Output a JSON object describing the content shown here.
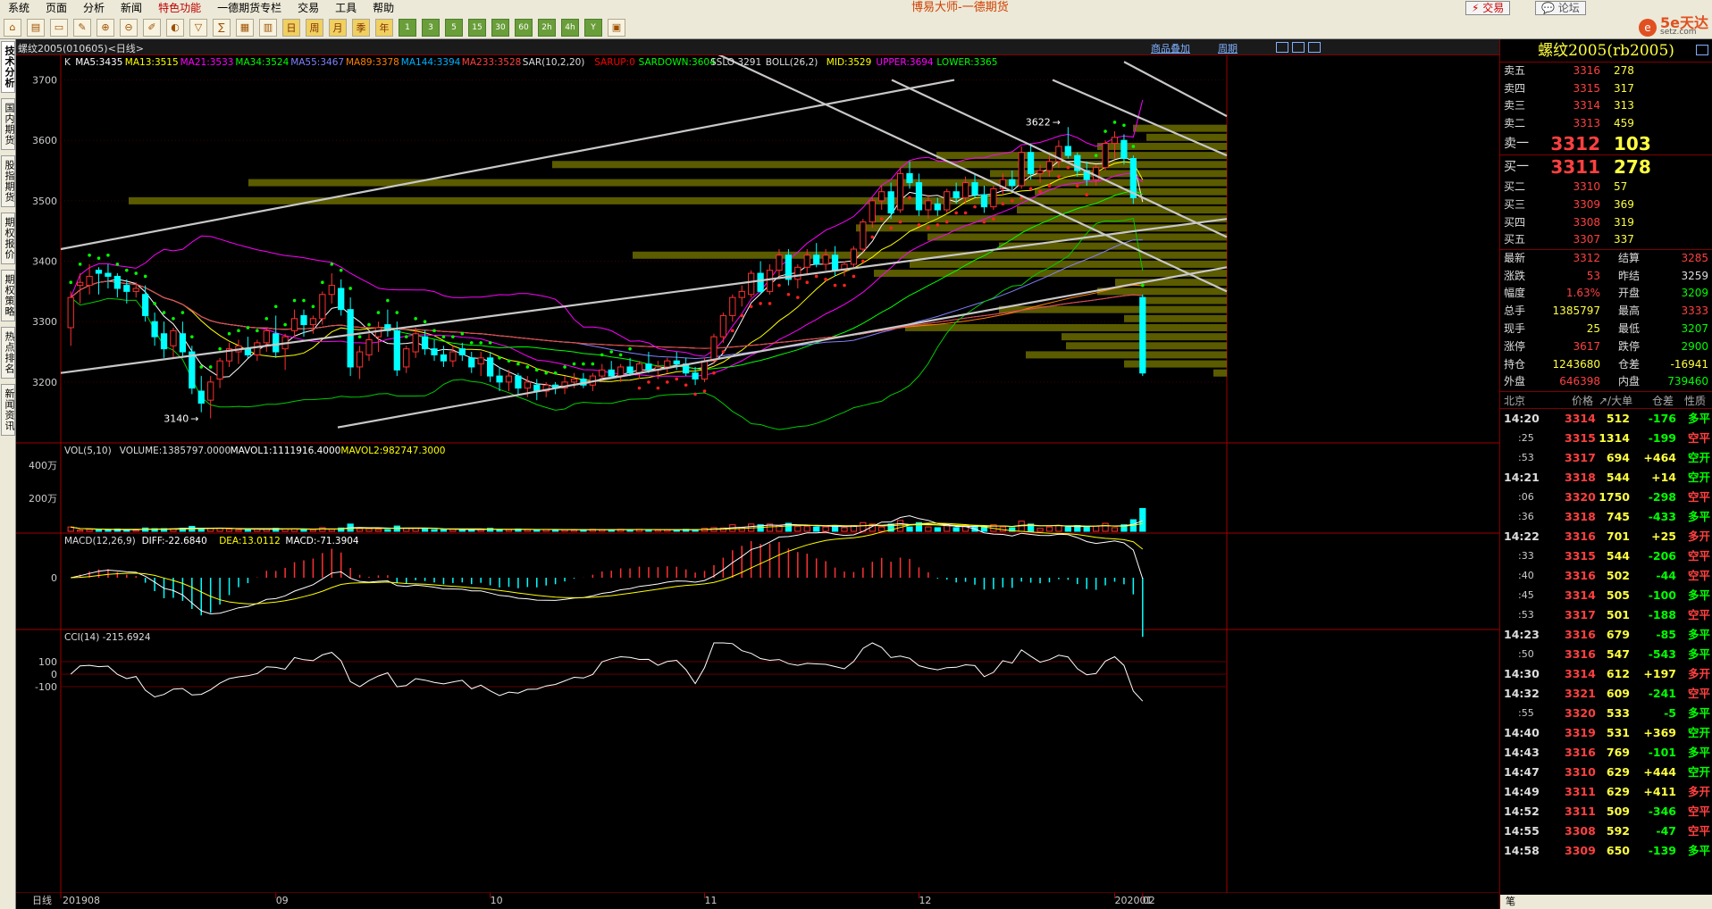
{
  "menubar": {
    "items": [
      "系统",
      "页面",
      "分析",
      "新闻",
      "特色功能",
      "一德期货专栏",
      "交易",
      "工具",
      "帮助"
    ],
    "highlight_index": 4,
    "app_title": "博易大师-一德期货",
    "trade_button": "交易",
    "forum_button": "论坛"
  },
  "toolbar": {
    "buttons": [
      "home-icon",
      "file-icon",
      "monitor-icon",
      "note-icon",
      "zoom-in-icon",
      "zoom-out-icon",
      "draw-icon",
      "paint-icon",
      "filter-icon",
      "calc-icon",
      "grid-icon",
      "bars-icon",
      "day",
      "week",
      "month",
      "quarter",
      "year",
      "1",
      "3",
      "5",
      "15",
      "30",
      "60",
      "2h",
      "4h",
      "Y",
      "calendar-icon"
    ],
    "labels": {
      "day": "日",
      "week": "周",
      "month": "月",
      "quarter": "季",
      "year": "年",
      "1": "1",
      "3": "3",
      "5": "5",
      "15": "15",
      "30": "30",
      "60": "60",
      "2h": "2h",
      "4h": "4h",
      "Y": "Y"
    }
  },
  "logo": {
    "circle": "e",
    "text": "5e天达",
    "sub": "setz.com"
  },
  "side_tabs": [
    "技术分析",
    "国内期货",
    "股指期货",
    "期权报价",
    "期权策略",
    "热点排名",
    "新闻资讯"
  ],
  "chart_header": {
    "symbol": "螺纹2005(010605)<日线>",
    "link1": "商品叠加",
    "link2": "周期"
  },
  "indicators": {
    "main": [
      {
        "text": "K",
        "color": "#dddddd"
      },
      {
        "text": "MA5:3435",
        "color": "#ffffff"
      },
      {
        "text": "MA13:3515",
        "color": "#ffff00"
      },
      {
        "text": "MA21:3533",
        "color": "#ff00ff"
      },
      {
        "text": "MA34:3524",
        "color": "#00ff00"
      },
      {
        "text": "MA55:3467",
        "color": "#8080ff"
      },
      {
        "text": "MA89:3378",
        "color": "#ff8000"
      },
      {
        "text": "MA144:3394",
        "color": "#00b0ff"
      },
      {
        "text": "MA233:3528",
        "color": "#ff4040"
      },
      {
        "text": "SAR(10,2,20)",
        "color": "#dddddd"
      },
      {
        "text": "SARUP:0",
        "color": "#ff0000"
      },
      {
        "text": "SARDOWN:3604",
        "color": "#00ff00"
      },
      {
        "text": "SSLO 3291",
        "color": "#dddddd"
      },
      {
        "text": "BOLL(26,2)",
        "color": "#dddddd"
      },
      {
        "text": "MID:3529",
        "color": "#ffff00"
      },
      {
        "text": "UPPER:3694",
        "color": "#ff00ff"
      },
      {
        "text": "LOWER:3365",
        "color": "#00ff00"
      }
    ],
    "vol": [
      {
        "text": "VOL(5,10)",
        "color": "#dddddd"
      },
      {
        "text": "VOLUME:1385797.0000",
        "color": "#dddddd"
      },
      {
        "text": "MAVOL1:1111916.4000",
        "color": "#ffffff"
      },
      {
        "text": "MAVOL2:982747.3000",
        "color": "#ffff00"
      }
    ],
    "macd": [
      {
        "text": "MACD(12,26,9)",
        "color": "#dddddd"
      },
      {
        "text": "DIFF:-22.6840",
        "color": "#ffffff"
      },
      {
        "text": "DEA:13.0112",
        "color": "#ffff00"
      },
      {
        "text": "MACD:-71.3904",
        "color": "#ffffff"
      }
    ],
    "cci": [
      {
        "text": "CCI(14) -215.6924",
        "color": "#dddddd"
      }
    ]
  },
  "y_axis": {
    "main": [
      "3700",
      "3600",
      "3500",
      "3400",
      "3300",
      "3200"
    ],
    "vol": [
      "400万",
      "200万"
    ],
    "macd": [
      "0"
    ],
    "cci": [
      "100",
      "0",
      "-100"
    ]
  },
  "x_axis": {
    "period_label": "日线",
    "dates": [
      "201908",
      "09",
      "10",
      "11",
      "12",
      "202001",
      "02"
    ]
  },
  "annotations": {
    "high": "3622",
    "low": "3140"
  },
  "chart_data": {
    "type": "candlestick",
    "ylim": [
      3120,
      3720
    ],
    "candles": [
      [
        3290,
        3350,
        3260,
        3340
      ],
      [
        3360,
        3380,
        3330,
        3365
      ],
      [
        3360,
        3395,
        3345,
        3375
      ],
      [
        3385,
        3390,
        3345,
        3380
      ],
      [
        3380,
        3395,
        3355,
        3375
      ],
      [
        3375,
        3380,
        3340,
        3355
      ],
      [
        3360,
        3370,
        3330,
        3350
      ],
      [
        3350,
        3365,
        3340,
        3355
      ],
      [
        3345,
        3360,
        3300,
        3310
      ],
      [
        3300,
        3315,
        3260,
        3275
      ],
      [
        3280,
        3300,
        3240,
        3255
      ],
      [
        3260,
        3290,
        3240,
        3285
      ],
      [
        3280,
        3300,
        3240,
        3250
      ],
      [
        3250,
        3260,
        3180,
        3190
      ],
      [
        3185,
        3210,
        3150,
        3165
      ],
      [
        3170,
        3210,
        3140,
        3200
      ],
      [
        3205,
        3240,
        3190,
        3235
      ],
      [
        3235,
        3265,
        3225,
        3255
      ],
      [
        3250,
        3270,
        3230,
        3260
      ],
      [
        3255,
        3275,
        3240,
        3245
      ],
      [
        3245,
        3270,
        3235,
        3265
      ],
      [
        3265,
        3290,
        3250,
        3285
      ],
      [
        3280,
        3310,
        3240,
        3250
      ],
      [
        3255,
        3280,
        3220,
        3275
      ],
      [
        3285,
        3320,
        3275,
        3305
      ],
      [
        3310,
        3320,
        3275,
        3295
      ],
      [
        3295,
        3310,
        3280,
        3305
      ],
      [
        3305,
        3350,
        3295,
        3345
      ],
      [
        3345,
        3380,
        3330,
        3360
      ],
      [
        3355,
        3370,
        3310,
        3320
      ],
      [
        3320,
        3340,
        3210,
        3225
      ],
      [
        3225,
        3260,
        3205,
        3250
      ],
      [
        3245,
        3280,
        3235,
        3270
      ],
      [
        3275,
        3300,
        3250,
        3290
      ],
      [
        3295,
        3320,
        3275,
        3285
      ],
      [
        3285,
        3300,
        3210,
        3220
      ],
      [
        3225,
        3260,
        3215,
        3255
      ],
      [
        3250,
        3290,
        3240,
        3280
      ],
      [
        3275,
        3285,
        3245,
        3255
      ],
      [
        3255,
        3270,
        3235,
        3245
      ],
      [
        3245,
        3260,
        3225,
        3235
      ],
      [
        3235,
        3260,
        3225,
        3250
      ],
      [
        3255,
        3265,
        3235,
        3245
      ],
      [
        3240,
        3250,
        3215,
        3225
      ],
      [
        3230,
        3250,
        3210,
        3240
      ],
      [
        3240,
        3250,
        3200,
        3210
      ],
      [
        3210,
        3225,
        3185,
        3200
      ],
      [
        3200,
        3220,
        3185,
        3210
      ],
      [
        3210,
        3215,
        3180,
        3190
      ],
      [
        3190,
        3210,
        3175,
        3200
      ],
      [
        3195,
        3205,
        3170,
        3185
      ],
      [
        3185,
        3200,
        3175,
        3195
      ],
      [
        3195,
        3200,
        3180,
        3190
      ],
      [
        3190,
        3210,
        3180,
        3200
      ],
      [
        3200,
        3215,
        3190,
        3205
      ],
      [
        3205,
        3215,
        3190,
        3195
      ],
      [
        3195,
        3215,
        3185,
        3210
      ],
      [
        3210,
        3230,
        3200,
        3220
      ],
      [
        3220,
        3235,
        3205,
        3210
      ],
      [
        3210,
        3230,
        3200,
        3225
      ],
      [
        3225,
        3240,
        3210,
        3215
      ],
      [
        3215,
        3235,
        3205,
        3230
      ],
      [
        3230,
        3250,
        3215,
        3220
      ],
      [
        3220,
        3235,
        3205,
        3225
      ],
      [
        3225,
        3240,
        3215,
        3235
      ],
      [
        3235,
        3250,
        3220,
        3230
      ],
      [
        3230,
        3240,
        3210,
        3215
      ],
      [
        3215,
        3225,
        3195,
        3205
      ],
      [
        3205,
        3240,
        3200,
        3235
      ],
      [
        3235,
        3280,
        3230,
        3275
      ],
      [
        3275,
        3315,
        3265,
        3310
      ],
      [
        3310,
        3345,
        3300,
        3340
      ],
      [
        3340,
        3360,
        3325,
        3350
      ],
      [
        3345,
        3385,
        3340,
        3380
      ],
      [
        3380,
        3400,
        3345,
        3350
      ],
      [
        3350,
        3395,
        3345,
        3385
      ],
      [
        3385,
        3420,
        3375,
        3410
      ],
      [
        3410,
        3420,
        3360,
        3370
      ],
      [
        3370,
        3395,
        3355,
        3390
      ],
      [
        3390,
        3420,
        3380,
        3410
      ],
      [
        3410,
        3430,
        3390,
        3395
      ],
      [
        3395,
        3420,
        3385,
        3410
      ],
      [
        3410,
        3425,
        3375,
        3385
      ],
      [
        3385,
        3400,
        3375,
        3395
      ],
      [
        3395,
        3425,
        3390,
        3420
      ],
      [
        3420,
        3470,
        3415,
        3465
      ],
      [
        3465,
        3505,
        3455,
        3500
      ],
      [
        3500,
        3525,
        3485,
        3515
      ],
      [
        3515,
        3530,
        3470,
        3480
      ],
      [
        3485,
        3555,
        3480,
        3545
      ],
      [
        3545,
        3565,
        3520,
        3530
      ],
      [
        3530,
        3545,
        3475,
        3485
      ],
      [
        3485,
        3510,
        3470,
        3500
      ],
      [
        3495,
        3505,
        3475,
        3485
      ],
      [
        3485,
        3520,
        3480,
        3515
      ],
      [
        3515,
        3530,
        3495,
        3505
      ],
      [
        3505,
        3540,
        3495,
        3530
      ],
      [
        3530,
        3545,
        3505,
        3510
      ],
      [
        3510,
        3525,
        3480,
        3490
      ],
      [
        3490,
        3525,
        3485,
        3520
      ],
      [
        3520,
        3545,
        3510,
        3535
      ],
      [
        3535,
        3550,
        3515,
        3525
      ],
      [
        3525,
        3590,
        3520,
        3580
      ],
      [
        3580,
        3595,
        3535,
        3545
      ],
      [
        3545,
        3560,
        3530,
        3550
      ],
      [
        3550,
        3575,
        3540,
        3565
      ],
      [
        3565,
        3600,
        3555,
        3590
      ],
      [
        3590,
        3622,
        3570,
        3575
      ],
      [
        3575,
        3580,
        3540,
        3550
      ],
      [
        3550,
        3565,
        3525,
        3535
      ],
      [
        3535,
        3560,
        3525,
        3555
      ],
      [
        3555,
        3600,
        3550,
        3595
      ],
      [
        3595,
        3615,
        3570,
        3605
      ],
      [
        3600,
        3610,
        3560,
        3570
      ],
      [
        3570,
        3575,
        3495,
        3505
      ],
      [
        3340,
        3345,
        3210,
        3215
      ]
    ],
    "last_close": 3312
  },
  "quote": {
    "title": "螺纹2005(rb2005)",
    "asks": [
      {
        "label": "卖五",
        "price": "3316",
        "vol": "278"
      },
      {
        "label": "卖四",
        "price": "3315",
        "vol": "317"
      },
      {
        "label": "卖三",
        "price": "3314",
        "vol": "313"
      },
      {
        "label": "卖二",
        "price": "3313",
        "vol": "459"
      }
    ],
    "ask1": {
      "label": "卖一",
      "price": "3312",
      "vol": "103"
    },
    "bid1": {
      "label": "买一",
      "price": "3311",
      "vol": "278"
    },
    "bids": [
      {
        "label": "买二",
        "price": "3310",
        "vol": "57"
      },
      {
        "label": "买三",
        "price": "3309",
        "vol": "369"
      },
      {
        "label": "买四",
        "price": "3308",
        "vol": "319"
      },
      {
        "label": "买五",
        "price": "3307",
        "vol": "337"
      }
    ],
    "info": [
      {
        "l1": "最新",
        "v1": "3312",
        "c1": "red",
        "l2": "结算",
        "v2": "3285",
        "c2": "red"
      },
      {
        "l1": "涨跌",
        "v1": "53",
        "c1": "red",
        "l2": "昨结",
        "v2": "3259",
        "c2": "wht"
      },
      {
        "l1": "幅度",
        "v1": "1.63%",
        "c1": "red",
        "l2": "开盘",
        "v2": "3209",
        "c2": "grn"
      },
      {
        "l1": "总手",
        "v1": "1385797",
        "c1": "yel",
        "l2": "最高",
        "v2": "3333",
        "c2": "red"
      },
      {
        "l1": "现手",
        "v1": "25",
        "c1": "yel",
        "l2": "最低",
        "v2": "3207",
        "c2": "grn"
      },
      {
        "l1": "涨停",
        "v1": "3617",
        "c1": "red",
        "l2": "跌停",
        "v2": "2900",
        "c2": "grn"
      },
      {
        "l1": "持仓",
        "v1": "1243680",
        "c1": "yel",
        "l2": "仓差",
        "v2": "-16941",
        "c2": "yel"
      },
      {
        "l1": "外盘",
        "v1": "646398",
        "c1": "red",
        "l2": "内盘",
        "v2": "739460",
        "c2": "grn"
      }
    ],
    "ticks_header": {
      "city": "北京",
      "price": "价格",
      "vol": "↗/大单",
      "oi": "仓差",
      "nature": "性质"
    },
    "ticks": [
      {
        "t": "14:20",
        "sub": false,
        "p": "3314",
        "v": "512",
        "o": "-176",
        "n": "多平",
        "pc": "red",
        "oc": "grn",
        "nc": "grn"
      },
      {
        "t": ":25",
        "sub": true,
        "p": "3315",
        "v": "1314",
        "o": "-199",
        "n": "空平",
        "pc": "red",
        "oc": "grn",
        "nc": "red"
      },
      {
        "t": ":53",
        "sub": true,
        "p": "3317",
        "v": "694",
        "o": "+464",
        "n": "空开",
        "pc": "red",
        "oc": "yel",
        "nc": "grn"
      },
      {
        "t": "14:21",
        "sub": false,
        "p": "3318",
        "v": "544",
        "o": "+14",
        "n": "空开",
        "pc": "red",
        "oc": "yel",
        "nc": "grn"
      },
      {
        "t": ":06",
        "sub": true,
        "p": "3320",
        "v": "1750",
        "o": "-298",
        "n": "空平",
        "pc": "red",
        "oc": "grn",
        "nc": "red"
      },
      {
        "t": ":36",
        "sub": true,
        "p": "3318",
        "v": "745",
        "o": "-433",
        "n": "多平",
        "pc": "red",
        "oc": "grn",
        "nc": "grn"
      },
      {
        "t": "14:22",
        "sub": false,
        "p": "3316",
        "v": "701",
        "o": "+25",
        "n": "多开",
        "pc": "red",
        "oc": "yel",
        "nc": "red"
      },
      {
        "t": ":33",
        "sub": true,
        "p": "3315",
        "v": "544",
        "o": "-206",
        "n": "空平",
        "pc": "red",
        "oc": "grn",
        "nc": "red"
      },
      {
        "t": ":40",
        "sub": true,
        "p": "3316",
        "v": "502",
        "o": "-44",
        "n": "空平",
        "pc": "red",
        "oc": "grn",
        "nc": "red"
      },
      {
        "t": ":45",
        "sub": true,
        "p": "3314",
        "v": "505",
        "o": "-100",
        "n": "多平",
        "pc": "red",
        "oc": "grn",
        "nc": "grn"
      },
      {
        "t": ":53",
        "sub": true,
        "p": "3317",
        "v": "501",
        "o": "-188",
        "n": "空平",
        "pc": "red",
        "oc": "grn",
        "nc": "red"
      },
      {
        "t": "14:23",
        "sub": false,
        "p": "3316",
        "v": "679",
        "o": "-85",
        "n": "多平",
        "pc": "red",
        "oc": "grn",
        "nc": "grn"
      },
      {
        "t": ":50",
        "sub": true,
        "p": "3316",
        "v": "547",
        "o": "-543",
        "n": "多平",
        "pc": "red",
        "oc": "grn",
        "nc": "grn"
      },
      {
        "t": "14:30",
        "sub": false,
        "p": "3314",
        "v": "612",
        "o": "+197",
        "n": "多开",
        "pc": "red",
        "oc": "yel",
        "nc": "red"
      },
      {
        "t": "14:32",
        "sub": false,
        "p": "3321",
        "v": "609",
        "o": "-241",
        "n": "空平",
        "pc": "red",
        "oc": "grn",
        "nc": "red"
      },
      {
        "t": ":55",
        "sub": true,
        "p": "3320",
        "v": "533",
        "o": "-5",
        "n": "多平",
        "pc": "red",
        "oc": "grn",
        "nc": "grn"
      },
      {
        "t": "14:40",
        "sub": false,
        "p": "3319",
        "v": "531",
        "o": "+369",
        "n": "空开",
        "pc": "red",
        "oc": "yel",
        "nc": "grn"
      },
      {
        "t": "14:43",
        "sub": false,
        "p": "3316",
        "v": "769",
        "o": "-101",
        "n": "多平",
        "pc": "red",
        "oc": "grn",
        "nc": "grn"
      },
      {
        "t": "14:47",
        "sub": false,
        "p": "3310",
        "v": "629",
        "o": "+444",
        "n": "空开",
        "pc": "red",
        "oc": "yel",
        "nc": "grn"
      },
      {
        "t": "14:49",
        "sub": false,
        "p": "3311",
        "v": "629",
        "o": "+411",
        "n": "多开",
        "pc": "red",
        "oc": "yel",
        "nc": "red"
      },
      {
        "t": "14:52",
        "sub": false,
        "p": "3311",
        "v": "509",
        "o": "-346",
        "n": "空平",
        "pc": "red",
        "oc": "grn",
        "nc": "red"
      },
      {
        "t": "14:55",
        "sub": false,
        "p": "3308",
        "v": "592",
        "o": "-47",
        "n": "空平",
        "pc": "red",
        "oc": "grn",
        "nc": "red"
      },
      {
        "t": "14:58",
        "sub": false,
        "p": "3309",
        "v": "650",
        "o": "-139",
        "n": "多平",
        "pc": "red",
        "oc": "grn",
        "nc": "grn"
      }
    ],
    "footer": "笔"
  }
}
